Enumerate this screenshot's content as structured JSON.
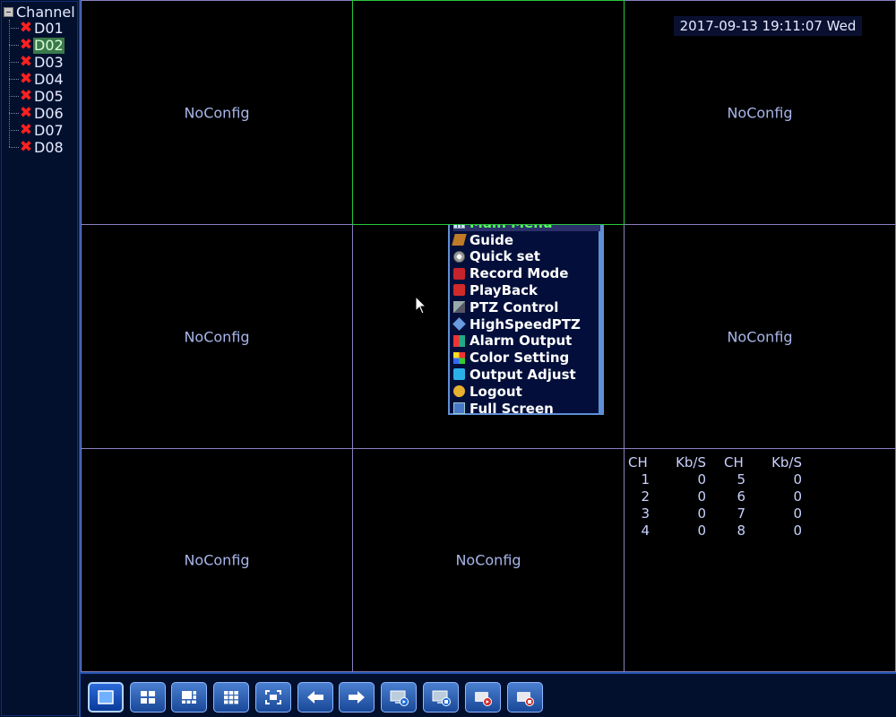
{
  "sidebar": {
    "root_label": "Channel",
    "channels": [
      {
        "label": "D01",
        "status": "disconnected"
      },
      {
        "label": "D02",
        "status": "disconnected",
        "selected": true
      },
      {
        "label": "D03",
        "status": "disconnected"
      },
      {
        "label": "D04",
        "status": "disconnected"
      },
      {
        "label": "D05",
        "status": "disconnected"
      },
      {
        "label": "D06",
        "status": "disconnected"
      },
      {
        "label": "D07",
        "status": "disconnected"
      },
      {
        "label": "D08",
        "status": "disconnected"
      }
    ]
  },
  "grid": {
    "cells": [
      {
        "label": "NoConfig"
      },
      {
        "label": "",
        "active": true
      },
      {
        "label": "NoConfig"
      },
      {
        "label": "NoConfig"
      },
      {
        "label": ""
      },
      {
        "label": "NoConfig"
      },
      {
        "label": "NoConfig"
      },
      {
        "label": "NoConfig"
      },
      {
        "label": ""
      }
    ]
  },
  "datetime": "2017-09-13 19:11:07 Wed",
  "bitrate": {
    "headers": [
      "CH",
      "Kb/S",
      "CH",
      "Kb/S"
    ],
    "rows": [
      [
        "1",
        "0",
        "5",
        "0"
      ],
      [
        "2",
        "0",
        "6",
        "0"
      ],
      [
        "3",
        "0",
        "7",
        "0"
      ],
      [
        "4",
        "0",
        "8",
        "0"
      ]
    ]
  },
  "context_menu": {
    "title": "Main Menu",
    "items": [
      {
        "label": "Guide",
        "icon": "guide-icon"
      },
      {
        "label": "Quick set",
        "icon": "quick-set-icon"
      },
      {
        "label": "Record Mode",
        "icon": "record-icon"
      },
      {
        "label": "PlayBack",
        "icon": "playback-icon"
      },
      {
        "label": "PTZ Control",
        "icon": "ptz-icon"
      },
      {
        "label": "HighSpeedPTZ",
        "icon": "high-speed-ptz-icon"
      },
      {
        "label": "Alarm Output",
        "icon": "alarm-icon"
      },
      {
        "label": "Color Setting",
        "icon": "color-icon"
      },
      {
        "label": "Output Adjust",
        "icon": "output-icon"
      },
      {
        "label": "Logout",
        "icon": "logout-icon"
      },
      {
        "label": "Full Screen",
        "icon": "fullscreen-icon"
      }
    ]
  },
  "toolbar": {
    "buttons": [
      {
        "name": "single-view-button",
        "icon": "single-screen-icon",
        "selected": true
      },
      {
        "name": "quad-view-button",
        "icon": "four-grid-icon"
      },
      {
        "name": "six-view-button",
        "icon": "six-grid-icon"
      },
      {
        "name": "nine-view-button",
        "icon": "nine-grid-icon"
      },
      {
        "name": "full-view-button",
        "icon": "fullscreen-icon"
      },
      {
        "name": "previous-button",
        "icon": "arrow-left-icon"
      },
      {
        "name": "next-button",
        "icon": "arrow-right-icon"
      },
      {
        "name": "play-button",
        "icon": "monitor-play-icon"
      },
      {
        "name": "stop-button",
        "icon": "monitor-stop-icon"
      },
      {
        "name": "record-start-button",
        "icon": "record-start-icon"
      },
      {
        "name": "record-stop-button",
        "icon": "record-stop-icon"
      }
    ]
  },
  "colors": {
    "accent": "#1d4fa8",
    "grid_line": "#8c7fc0",
    "active_line": "#28c83c",
    "menu_header": "#58ff58",
    "error_mark": "#ff2020"
  }
}
